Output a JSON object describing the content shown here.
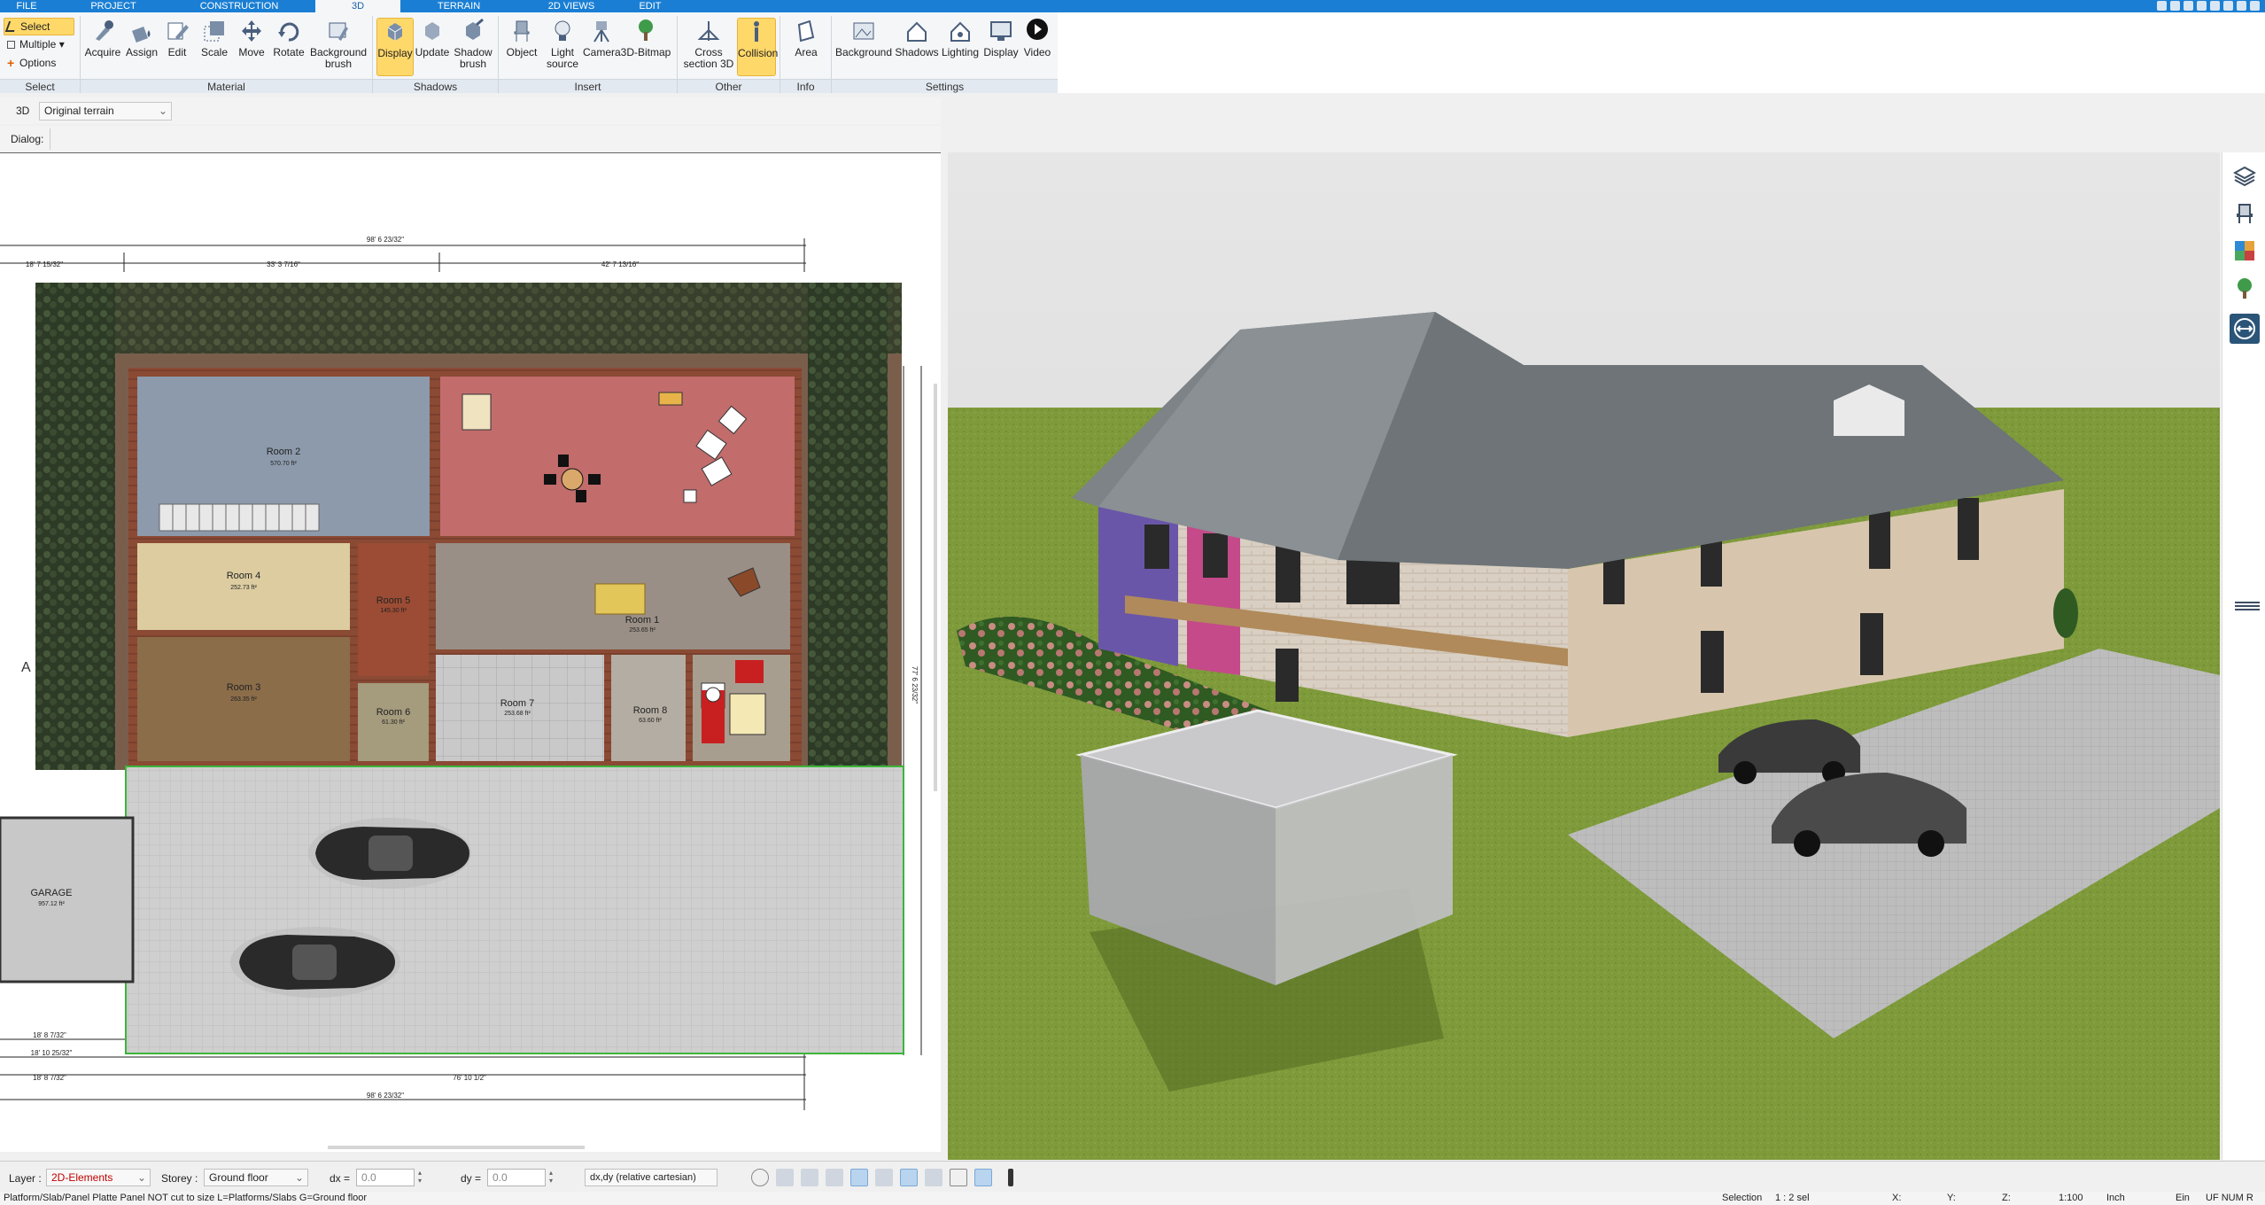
{
  "menu_tabs": [
    "FILE",
    "PROJECT",
    "CONSTRUCTION",
    "3D",
    "TERRAIN",
    "2D VIEWS",
    "EDIT"
  ],
  "active_tab": "3D",
  "ribbon": {
    "select_group": {
      "items": [
        "Select",
        "Multiple",
        "Options"
      ],
      "label": "Select"
    },
    "material": {
      "buttons": [
        "Acquire",
        "Assign",
        "Edit",
        "Scale",
        "Move",
        "Rotate",
        "Background brush"
      ],
      "label": "Material"
    },
    "shadows": {
      "buttons": [
        "Display",
        "Update",
        "Shadow brush"
      ],
      "label": "Shadows"
    },
    "insert": {
      "buttons": [
        "Object",
        "Light source",
        "Camera",
        "3D-Bitmap"
      ],
      "label": "Insert"
    },
    "other": {
      "buttons": [
        "Cross section 3D",
        "Collision"
      ],
      "label": "Other"
    },
    "info": {
      "buttons": [
        "Area"
      ],
      "label": "Info"
    },
    "settings": {
      "buttons": [
        "Background",
        "Shadows",
        "Lighting",
        "Display",
        "Video"
      ],
      "label": "Settings"
    }
  },
  "context": {
    "mode": "3D",
    "terrain_select": "Original terrain",
    "dialog_label": "Dialog:"
  },
  "plan": {
    "rooms": [
      {
        "name": "Room 2",
        "area": "570.70 ft²"
      },
      {
        "name": "Room 4",
        "area": "252.73 ft²"
      },
      {
        "name": "Room 3",
        "area": "263.35 ft²"
      },
      {
        "name": "Room 1",
        "area": "253.65 ft²"
      },
      {
        "name": "Room 7",
        "area": "253.68 ft²"
      },
      {
        "name": "Room 5",
        "area": "145.30 ft²"
      },
      {
        "name": "Room 6",
        "area": "61.30 ft²"
      },
      {
        "name": "Room 8",
        "area": "63.60 ft²"
      },
      {
        "name": "GARAGE",
        "area": "957.12 ft²"
      }
    ],
    "dimensions": {
      "top_total": "98' 6 23/32\"",
      "top_left": "33' 3 7/16\"",
      "top_right": "42' 7 13/16\"",
      "left_top": "18' 7 15/32\"",
      "bottom_total": "98' 6 23/32\"",
      "bottom_mid": "76' 10 1/2\"",
      "bottom_left1": "18' 8 7/32\"",
      "bottom_left2": "18' 10 25/32\"",
      "bottom_left3": "18' 8 7/32\"",
      "right_side": "77' 6 23/32\""
    },
    "compass": "A"
  },
  "status": {
    "layer_label": "Layer :",
    "layer_value": "2D-Elements",
    "storey_label": "Storey :",
    "storey_value": "Ground floor",
    "dx_label": "dx =",
    "dx_value": "0.0",
    "dy_label": "dy =",
    "dy_value": "0.0",
    "coord_mode": "dx,dy (relative cartesian)",
    "hint": "Platform/Slab/Panel Platte Panel NOT cut to size L=Platforms/Slabs G=Ground floor",
    "selection_label": "Selection",
    "selection_value": "1 : 2 sel",
    "x_label": "X:",
    "y_label": "Y:",
    "z_label": "Z:",
    "scale": "1:100",
    "unit": "Inch",
    "ein": "Ein",
    "flags": "UF NUM R"
  },
  "colors": {
    "accent": "#1a7fd4",
    "highlight": "#ffd86a",
    "layer_text": "#c00000"
  },
  "icons": [
    "layers-icon",
    "chair-icon",
    "texture-icon",
    "tree-icon",
    "swap-icon"
  ]
}
